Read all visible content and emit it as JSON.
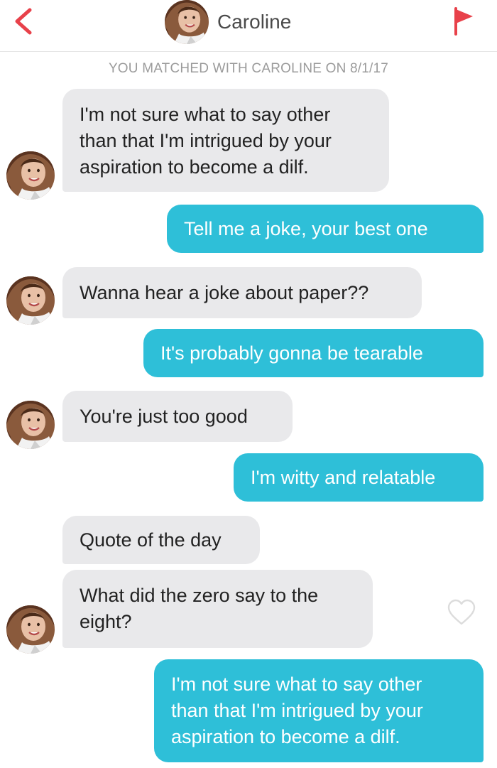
{
  "header": {
    "name": "Caroline",
    "back_icon": "chevron-left-icon",
    "flag_icon": "flag-icon",
    "accent_color": "#e8414a"
  },
  "match_note": "YOU MATCHED WITH CAROLINE ON 8/1/17",
  "messages": [
    {
      "from": "them",
      "text": "I'm not sure what to say other\nthan that I'm intrigued by your\naspiration to become a dilf."
    },
    {
      "from": "me",
      "text": "Tell me a joke, your best one"
    },
    {
      "from": "them",
      "text": "Wanna hear a joke about paper??"
    },
    {
      "from": "me",
      "text": "It's probably gonna be tearable"
    },
    {
      "from": "them",
      "text": "You're just too good"
    },
    {
      "from": "me",
      "text": "I'm witty and relatable"
    },
    {
      "from": "them",
      "text": "Quote of the day"
    },
    {
      "from": "them",
      "text": "What did the zero say to the\neight?"
    },
    {
      "from": "me",
      "text": "I'm not sure what to say other\nthan that I'm intrigued by your\naspiration to become a dilf."
    }
  ],
  "colors": {
    "sent_bubble": "#2ebfd8",
    "received_bubble": "#e9e9eb"
  }
}
